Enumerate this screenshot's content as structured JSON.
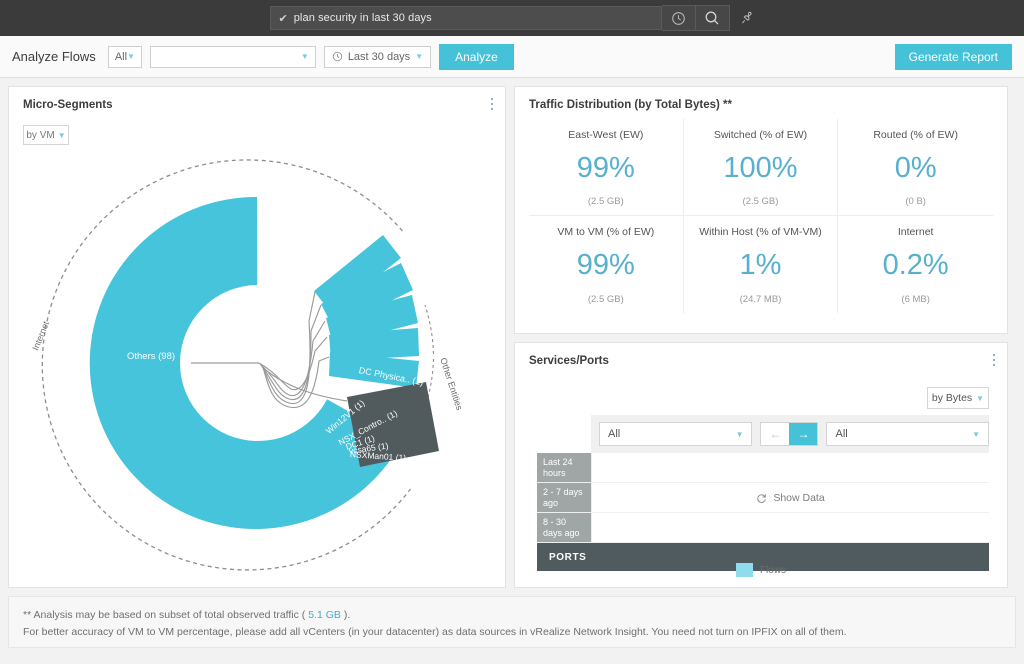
{
  "topbar": {
    "search_value": "plan security in last 30 days",
    "check_icon": "check-icon",
    "history_icon": "clock-history-icon",
    "search_icon": "search-icon",
    "pin_icon": "pin-icon"
  },
  "toolbar": {
    "title": "Analyze Flows",
    "entity_filter": "All",
    "query_placeholder": "",
    "query_value": "",
    "time_range": "Last 30 days",
    "analyze_label": "Analyze",
    "generate_report_label": "Generate Report"
  },
  "micro_segments": {
    "title": "Micro-Segments",
    "group_by": "by VM",
    "kebab": "more-options-icon"
  },
  "traffic": {
    "title": "Traffic Distribution (by Total Bytes) **",
    "metrics": [
      {
        "label": "East-West (EW)",
        "value": "99%",
        "sub": "(2.5 GB)"
      },
      {
        "label": "Switched (% of EW)",
        "value": "100%",
        "sub": "(2.5 GB)"
      },
      {
        "label": "Routed (% of EW)",
        "value": "0%",
        "sub": "(0 B)"
      },
      {
        "label": "VM to VM (% of EW)",
        "value": "99%",
        "sub": "(2.5 GB)"
      },
      {
        "label": "Within Host (% of VM-VM)",
        "value": "1%",
        "sub": "(24.7 MB)"
      },
      {
        "label": "Internet",
        "value": "0.2%",
        "sub": "(6 MB)"
      }
    ]
  },
  "ports": {
    "title": "Services/Ports",
    "kebab": "more-options-icon",
    "sort_by": "by Bytes",
    "filter_left": "All",
    "filter_right": "All",
    "prev_label": "←",
    "next_label": "→",
    "rows": [
      "Last 24 hours",
      "2 - 7 days ago",
      "8 - 30 days ago"
    ],
    "show_data_label": "Show Data",
    "refresh_icon": "refresh-icon",
    "footer_label": "PORTS",
    "legend_label": "Flows",
    "legend_color": "#8fdcec"
  },
  "footer": {
    "line1_pre": "** Analysis may be based on subset of total observed traffic ( ",
    "line1_link": "5.1 GB",
    "line1_post": " ).",
    "line2": "For better accuracy of VM to VM percentage, please add all vCenters (in your datacenter) as data sources in vRealize Network Insight. You need not turn on IPFIX on all of them."
  },
  "chart_data": {
    "type": "pie",
    "title": "Micro-Segments",
    "subtitle": "by VM",
    "inner_radius_ratio": 0.47,
    "outer_ring_labels": [
      {
        "label": "Internet",
        "start_deg": 150,
        "end_deg": 210
      },
      {
        "label": "Other Entities",
        "start_deg": 348,
        "end_deg": 12
      }
    ],
    "colors": {
      "primary": "#45c4db",
      "other_entities": "#515b5e"
    },
    "categories": [
      "Others (98)",
      "Win12V1 (1)",
      "NSX_Contro.. (1)",
      "DC1 (1)",
      "vcsa65 (1)",
      "NSXMan01 (1)",
      "DC Physica.. (1)"
    ],
    "values": [
      98,
      1,
      1,
      1,
      1,
      1,
      1
    ],
    "segments": [
      {
        "label": "Others (98)",
        "count": 98,
        "color": "#45c4db",
        "exploded": false
      },
      {
        "label": "Win12V1 (1)",
        "count": 1,
        "color": "#45c4db",
        "exploded": true
      },
      {
        "label": "NSX_Contro.. (1)",
        "count": 1,
        "color": "#45c4db",
        "exploded": true
      },
      {
        "label": "DC1 (1)",
        "count": 1,
        "color": "#45c4db",
        "exploded": true
      },
      {
        "label": "vcsa65 (1)",
        "count": 1,
        "color": "#45c4db",
        "exploded": true
      },
      {
        "label": "NSXMan01 (1)",
        "count": 1,
        "color": "#45c4db",
        "exploded": true
      },
      {
        "label": "DC Physica.. (1)",
        "count": 1,
        "color": "#515b5e",
        "exploded": true
      }
    ],
    "legend": "none",
    "grid": false
  }
}
